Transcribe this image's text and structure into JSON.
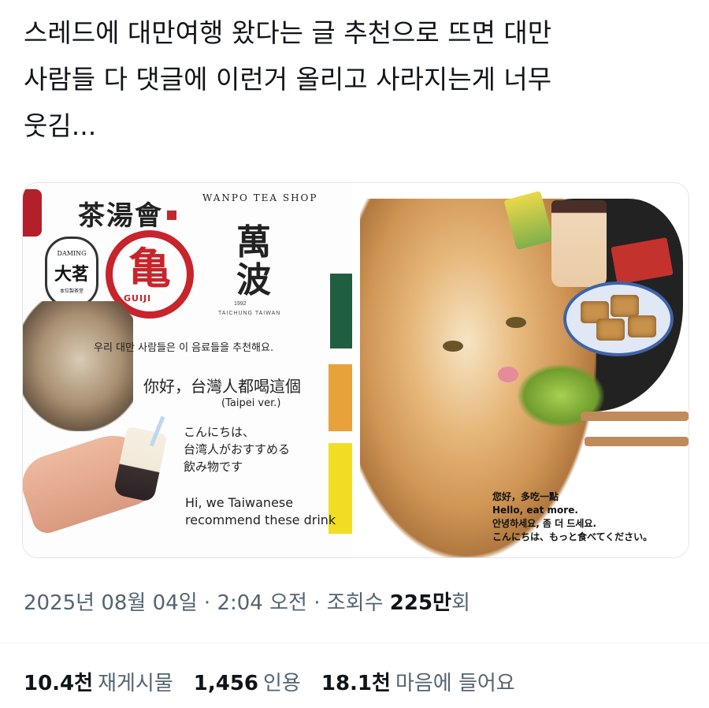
{
  "post": {
    "text": "스레드에 대만여행 왔다는 글 추천으로 뜨면 대만\n사람들 다 댓글에 이런거 올리고 사라지는게 너무\n웃김..."
  },
  "media": {
    "left": {
      "brand1": "茶湯會",
      "brand2_small": "DAMING",
      "brand2": "大茗",
      "brand2_sub": "本位製茶堂",
      "brand3": "GUIJI",
      "brand4_arc": "WANPO TEA SHOP",
      "brand4": "萬波",
      "brand4_year": "1992",
      "brand4_city": "TAICHUNG TAIWAN",
      "caption_ko": "우리 대만 사람들은 이 음료들을 추천해요.",
      "caption_zh": "你好，台灣人都喝這個",
      "caption_sub": "(Taipei ver.)",
      "caption_ja": "こんにちは、\n台湾人がおすすめる\n飲み物です",
      "caption_en": "Hi, we Taiwanese\nrecommend these drink"
    },
    "right": {
      "caption": "您好，多吃一點\nHello, eat more.\n안녕하세요, 좀 더 드세요.\nこんにちは、もっと食べてください。"
    }
  },
  "meta": {
    "date": "2025년 08월 04일",
    "sep1": " · ",
    "time": "2:04 오전",
    "sep2": " · ",
    "views_label": "조회수 ",
    "views_num": "225만",
    "views_unit": "회"
  },
  "stats": {
    "reposts_num": "10.4천",
    "reposts_label": "재게시물",
    "quotes_num": "1,456",
    "quotes_label": "인용",
    "likes_num": "18.1천",
    "likes_label": "마음에 들어요"
  }
}
